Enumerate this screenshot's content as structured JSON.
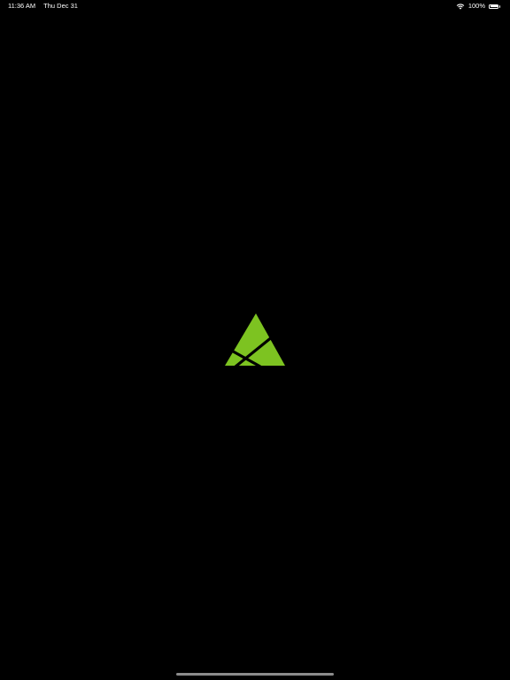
{
  "status_bar": {
    "time": "11:36 AM",
    "date": "Thu Dec 31",
    "battery_percent": "100%",
    "battery_level": 1.0,
    "icons": [
      "wifi-icon",
      "battery-icon"
    ]
  },
  "splash": {
    "logo_icon": "triangle-logo-icon",
    "logo_color": "#7dc321",
    "background_color": "#000000"
  }
}
